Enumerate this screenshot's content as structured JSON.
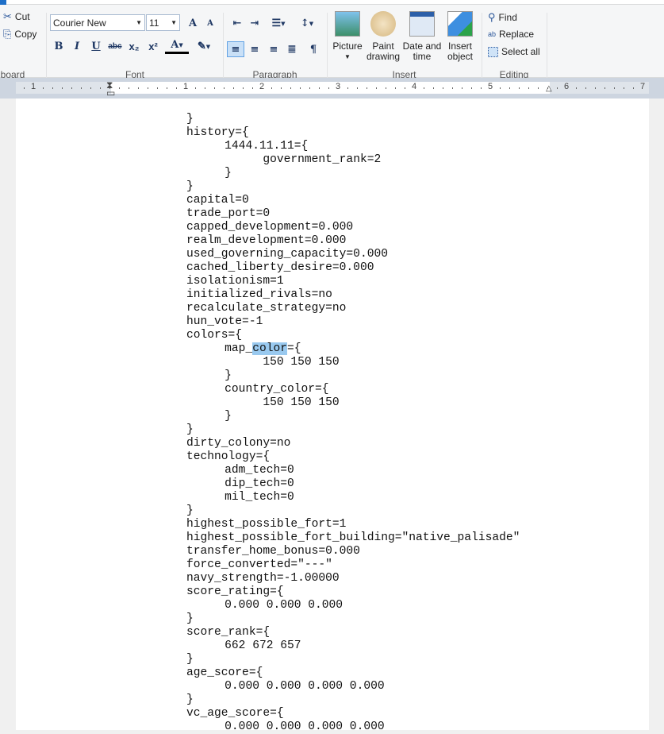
{
  "clipboard": {
    "cut": "Cut",
    "copy": "Copy",
    "group_label": "board"
  },
  "font": {
    "family": "Courier New",
    "size": "11",
    "group_label": "Font",
    "bold": "B",
    "italic": "I",
    "underline": "U",
    "strike": "abc",
    "sub": "x₂",
    "sup": "x²",
    "grow": "A",
    "shrink": "A",
    "color": "A"
  },
  "paragraph": {
    "group_label": "Paragraph"
  },
  "insert": {
    "group_label": "Insert",
    "picture": "Picture",
    "paint": [
      "Paint",
      "drawing"
    ],
    "datetime": [
      "Date and",
      "time"
    ],
    "object": [
      "Insert",
      "object"
    ]
  },
  "editing": {
    "group_label": "Editing",
    "find": "Find",
    "replace": "Replace",
    "select_all": "Select all"
  },
  "ruler": {
    "labels": [
      "1",
      "1",
      "2",
      "3",
      "4",
      "5",
      "6",
      "7"
    ]
  },
  "document": {
    "lines": [
      "}",
      "history={",
      "\t1444.11.11={",
      "\t\tgovernment_rank=2",
      "\t}",
      "}",
      "capital=0",
      "trade_port=0",
      "capped_development=0.000",
      "realm_development=0.000",
      "used_governing_capacity=0.000",
      "cached_liberty_desire=0.000",
      "isolationism=1",
      "initialized_rivals=no",
      "recalculate_strategy=no",
      "hun_vote=-1",
      "colors={",
      "\tmap_",
      "\t\t150 150 150",
      "\t}",
      "\tcountry_color={",
      "\t\t150 150 150",
      "\t}",
      "}",
      "dirty_colony=no",
      "technology={",
      "\tadm_tech=0",
      "\tdip_tech=0",
      "\tmil_tech=0",
      "}",
      "highest_possible_fort=1",
      "highest_possible_fort_building=\"native_palisade\"",
      "transfer_home_bonus=0.000",
      "force_converted=\"---\"",
      "navy_strength=-1.00000",
      "score_rating={",
      "\t0.000 0.000 0.000",
      "}",
      "score_rank={",
      "\t662 672 657",
      "}",
      "age_score={",
      "\t0.000 0.000 0.000 0.000",
      "}",
      "vc_age_score={",
      "\t0.000 0.000 0.000 0.000"
    ],
    "selected_word": "color",
    "after_selection": "={",
    "selection_color": "#99c9ef"
  }
}
